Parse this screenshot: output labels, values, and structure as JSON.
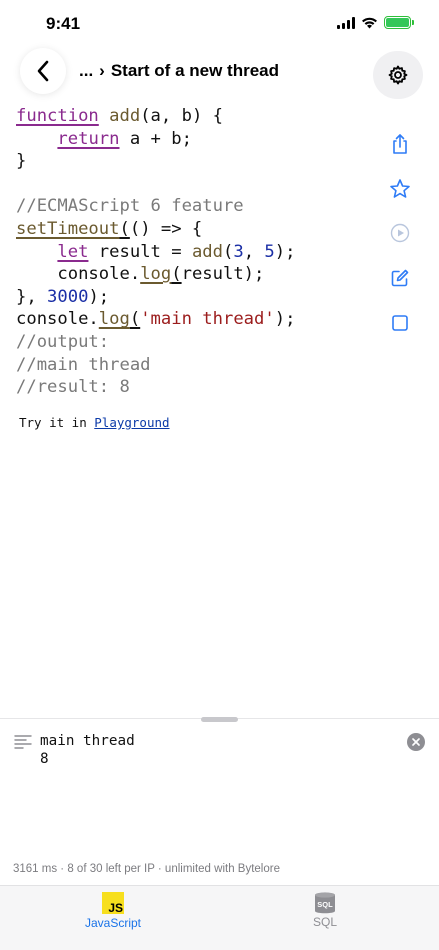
{
  "status_bar": {
    "time": "9:41"
  },
  "header": {
    "ellipsis": "...",
    "separator": "›",
    "title": "Start of a new thread"
  },
  "code_lines": [
    [
      {
        "t": "function",
        "c": "kw"
      },
      {
        "t": " "
      },
      {
        "t": "add",
        "c": "fn"
      },
      {
        "t": "(a, b) {"
      }
    ],
    [
      {
        "t": "    "
      },
      {
        "t": "return",
        "c": "kw"
      },
      {
        "t": " a + b;"
      }
    ],
    [
      {
        "t": "}"
      }
    ],
    [
      {
        "t": ""
      }
    ],
    [
      {
        "t": "//ECMAScript 6 feature",
        "c": "cm"
      }
    ],
    [
      {
        "t": "setTimeout",
        "c": "fnu"
      },
      {
        "t": "(",
        "c": "ul"
      },
      {
        "t": "() => {"
      }
    ],
    [
      {
        "t": "    "
      },
      {
        "t": "let",
        "c": "kw"
      },
      {
        "t": " result = "
      },
      {
        "t": "add",
        "c": "fn"
      },
      {
        "t": "("
      },
      {
        "t": "3",
        "c": "num"
      },
      {
        "t": ", "
      },
      {
        "t": "5",
        "c": "num"
      },
      {
        "t": ");"
      }
    ],
    [
      {
        "t": "    console."
      },
      {
        "t": "log",
        "c": "fnu"
      },
      {
        "t": "(",
        "c": "ul"
      },
      {
        "t": "result);"
      }
    ],
    [
      {
        "t": "}, "
      },
      {
        "t": "3000",
        "c": "num"
      },
      {
        "t": ");"
      }
    ],
    [
      {
        "t": "console."
      },
      {
        "t": "log",
        "c": "fnu"
      },
      {
        "t": "(",
        "c": "ul"
      },
      {
        "t": "'main thread'",
        "c": "str"
      },
      {
        "t": ");"
      }
    ],
    [
      {
        "t": "//output:",
        "c": "cm"
      }
    ],
    [
      {
        "t": "//main thread",
        "c": "cm"
      }
    ],
    [
      {
        "t": "//result: 8",
        "c": "cm"
      }
    ]
  ],
  "playground": {
    "prefix": "Try it in ",
    "link": "Playground"
  },
  "console": {
    "output": "main thread\n8"
  },
  "stats": "3161 ms · 8 of 30 left per IP · unlimited with Bytelore",
  "tabs": [
    {
      "label": "JavaScript",
      "icon": "js-logo",
      "logo_text": "JS",
      "active": true,
      "color": "#1a73e8"
    },
    {
      "label": "SQL",
      "icon": "sql-database-icon",
      "logo_text": "SQL",
      "active": false,
      "color": "#8e8e93"
    }
  ],
  "colors": {
    "accent": "#2f7cf6",
    "keyword": "#8a2a8e",
    "number": "#1b2fa6",
    "string": "#9b1c1c",
    "comment": "#7a7a7a",
    "js_yellow": "#f7df1e"
  }
}
